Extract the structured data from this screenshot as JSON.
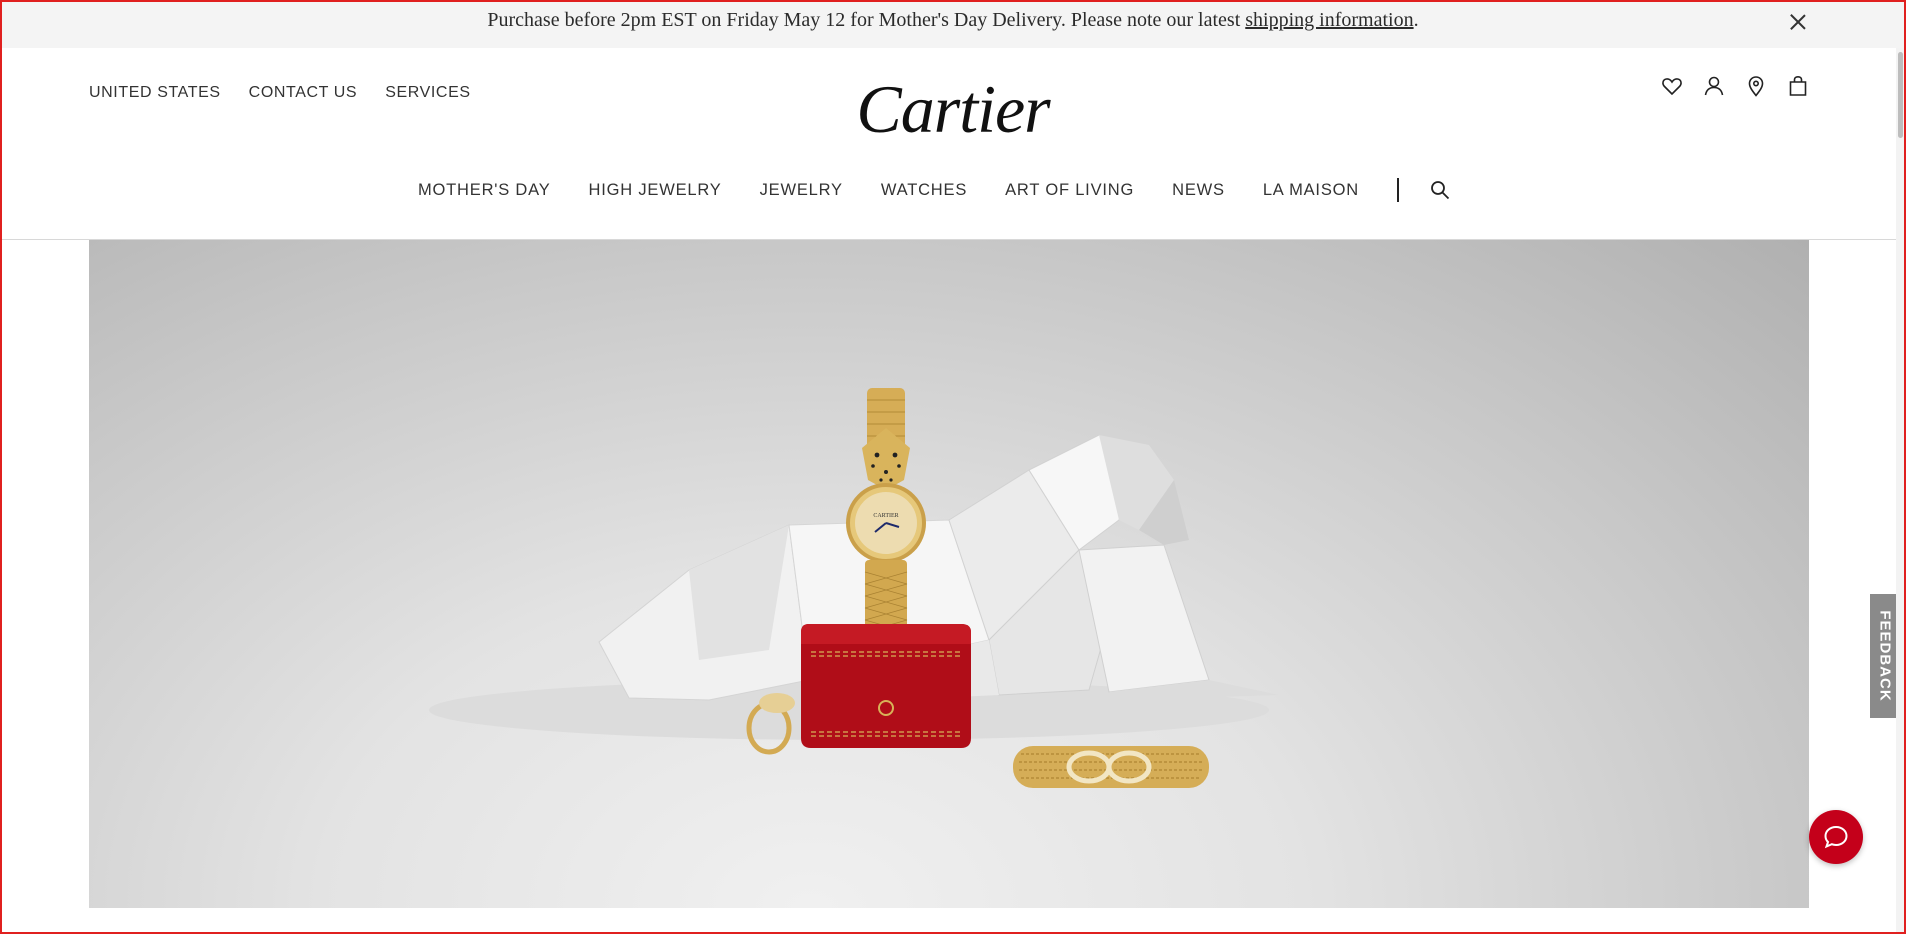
{
  "banner": {
    "message": "Purchase before 2pm EST on Friday May 12 for Mother's Day Delivery. Please note our latest ",
    "link_text": "shipping information",
    "period": ".",
    "close_icon": "close-icon"
  },
  "header": {
    "util_links": [
      "UNITED STATES",
      "CONTACT US",
      "SERVICES"
    ],
    "logo": "Cartier",
    "icons": [
      "heart-icon",
      "user-icon",
      "location-pin-icon",
      "shopping-bag-icon"
    ],
    "nav": [
      "MOTHER'S DAY",
      "HIGH JEWELRY",
      "JEWELRY",
      "WATCHES",
      "ART OF LIVING",
      "NEWS",
      "LA MAISON"
    ],
    "search_icon": "search-icon"
  },
  "hero": {
    "watch_dial_brand": "CARTIER"
  },
  "feedback": {
    "label": "FEEDBACK"
  },
  "colors": {
    "frame": "#e0201f",
    "chat": "#c4001a",
    "box_red": "#b00d18",
    "gold": "#d8b258"
  }
}
